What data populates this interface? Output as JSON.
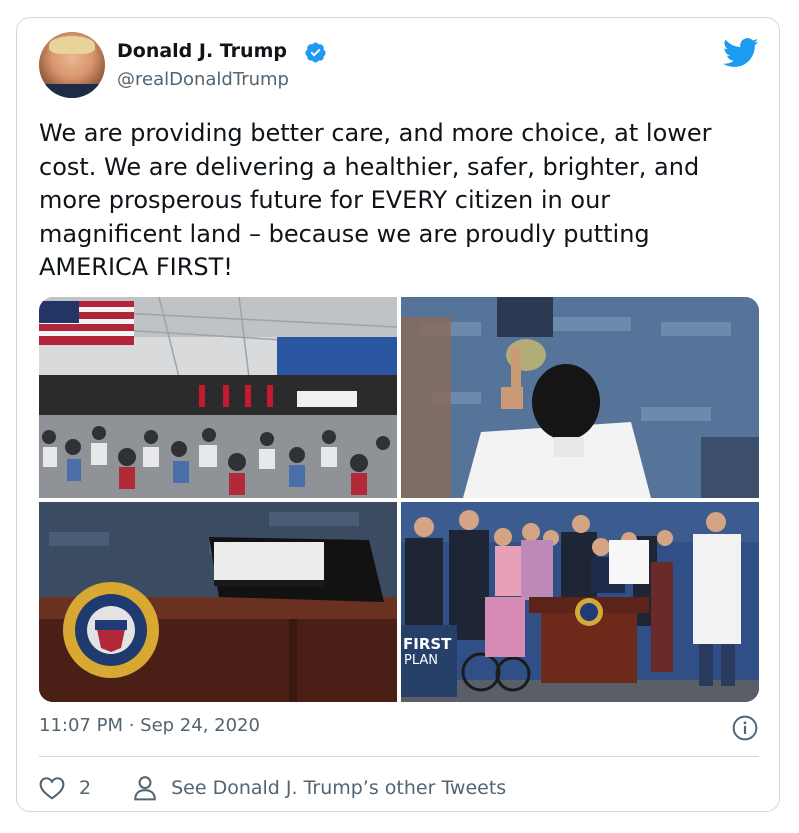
{
  "author": {
    "name": "Donald J. Trump",
    "handle": "@realDonaldTrump",
    "verified": true
  },
  "tweet": {
    "text": "We are providing better care, and more choice, at lower cost. We are delivering a healthier, safer, brighter, and more prosperous future for EVERY citizen in our magnificent land – because we are proudly putting AMERICA FIRST!",
    "timestamp": "11:07 PM · Sep 24, 2020"
  },
  "media": {
    "photo4_sign_line1": "FIRST",
    "photo4_sign_line2": "PLAN"
  },
  "actions": {
    "like_count": "2",
    "see_other_label": "See Donald J. Trump’s other Tweets"
  },
  "colors": {
    "brand": "#1d9bf0",
    "secondary_text": "#536471",
    "border": "#cfd9de"
  },
  "icons": [
    "verified-badge-icon",
    "twitter-bird-icon",
    "info-icon",
    "heart-icon",
    "person-icon"
  ]
}
